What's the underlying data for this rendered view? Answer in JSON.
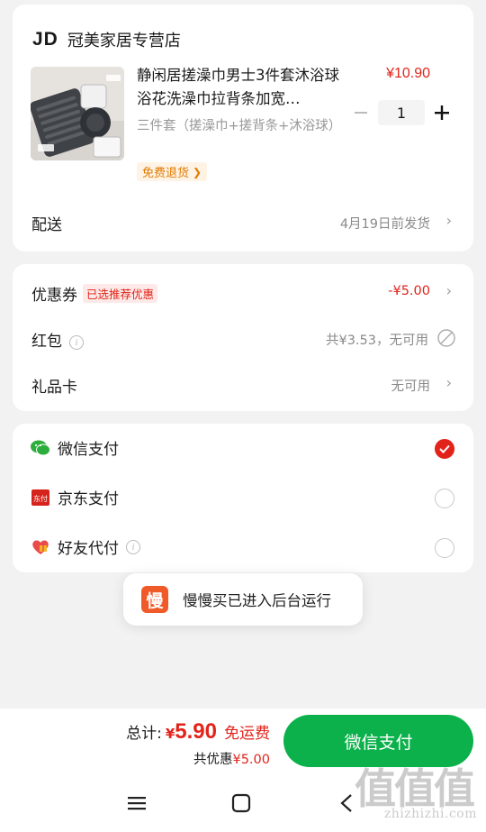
{
  "store": {
    "logo": "JD",
    "name": "冠美家居专营店"
  },
  "product": {
    "title": "静闲居搓澡巾男士3件套沐浴球浴花洗澡巾拉背条加宽…",
    "price": "¥10.90",
    "spec": "三件套（搓澡巾+搓背条+沐浴球）",
    "return_badge": "免费退货",
    "quantity": "1",
    "image_labels": [
      "搓澡巾",
      "搓背条",
      "沐浴球"
    ]
  },
  "delivery": {
    "label": "配送",
    "value": "4月19日前发货"
  },
  "discounts": {
    "coupon_label": "优惠券",
    "coupon_tag": "已选推荐优惠",
    "coupon_value": "-¥5.00",
    "redpacket_label": "红包",
    "redpacket_value": "共¥3.53，无可用",
    "giftcard_label": "礼品卡",
    "giftcard_value": "无可用"
  },
  "payment": {
    "options": [
      {
        "label": "微信支付",
        "selected": true
      },
      {
        "label": "京东支付",
        "selected": false
      },
      {
        "label": "好友代付",
        "selected": false
      }
    ],
    "jd_icon_text": "东付"
  },
  "toast": {
    "icon_text": "慢",
    "text": "慢慢买已进入后台运行"
  },
  "footer": {
    "total_label": "总计:",
    "currency": "¥",
    "total_amount": "5.90",
    "free_shipping": "免运费",
    "saved_label": "共优惠",
    "saved_amount": "¥5.00",
    "pay_button": "微信支付"
  },
  "watermark": {
    "big": "值值值",
    "small": "zhizhizhi.com"
  },
  "colors": {
    "accent_red": "#e2231a",
    "wechat_green": "#0cb14b",
    "toast_orange": "#f05a28"
  }
}
